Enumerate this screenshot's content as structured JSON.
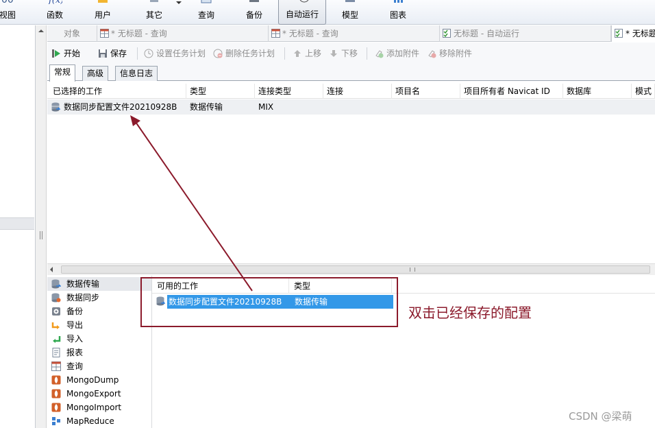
{
  "ribbon": {
    "items": [
      {
        "label": "视图",
        "icon": "view-icon"
      },
      {
        "label": "函数",
        "icon": "function-icon"
      },
      {
        "label": "用户",
        "icon": "user-icon"
      },
      {
        "label": "其它",
        "icon": "other-icon"
      },
      {
        "label": "查询",
        "icon": "query-icon"
      },
      {
        "label": "备份",
        "icon": "backup-icon"
      },
      {
        "label": "自动运行",
        "icon": "automation-icon",
        "active": true
      },
      {
        "label": "模型",
        "icon": "model-icon"
      },
      {
        "label": "图表",
        "icon": "chart-icon"
      }
    ]
  },
  "tabs": [
    {
      "label": "对象"
    },
    {
      "label": "* 无标题 - 查询",
      "icon": "query-tab-icon"
    },
    {
      "label": "* 无标题 - 查询",
      "icon": "query-tab-icon"
    },
    {
      "label": "无标题 - 自动运行",
      "icon": "automation-tab-icon"
    },
    {
      "label": "* 无标题",
      "icon": "automation-tab-icon",
      "active": true
    }
  ],
  "toolbar": {
    "start": "开始",
    "save": "保存",
    "set_schedule": "设置任务计划",
    "delete_schedule": "删除任务计划",
    "move_up": "上移",
    "move_down": "下移",
    "add_attachment": "添加附件",
    "remove_attachment": "移除附件"
  },
  "subtabs": {
    "general": "常规",
    "advanced": "高级",
    "log": "信息日志"
  },
  "grid": {
    "columns": [
      "已选择的工作",
      "类型",
      "连接类型",
      "连接",
      "项目名",
      "项目所有者 Navicat ID",
      "数据库",
      "模式"
    ],
    "rows": [
      [
        "数据同步配置文件20210928B",
        "数据传输",
        "MIX",
        "",
        "",
        "",
        "",
        ""
      ]
    ]
  },
  "typelist": {
    "items": [
      {
        "label": "数据传输",
        "icon": "data-transfer-icon",
        "selected": true
      },
      {
        "label": "数据同步",
        "icon": "data-sync-icon"
      },
      {
        "label": "备份",
        "icon": "backup-icon"
      },
      {
        "label": "导出",
        "icon": "export-icon"
      },
      {
        "label": "导入",
        "icon": "import-icon"
      },
      {
        "label": "报表",
        "icon": "report-icon"
      },
      {
        "label": "查询",
        "icon": "query-icon"
      },
      {
        "label": "MongoDump",
        "icon": "mongodump-icon"
      },
      {
        "label": "MongoExport",
        "icon": "mongoexport-icon"
      },
      {
        "label": "MongoImport",
        "icon": "mongoimport-icon"
      },
      {
        "label": "MapReduce",
        "icon": "mapreduce-icon"
      }
    ]
  },
  "available": {
    "columns": [
      "可用的工作",
      "类型"
    ],
    "rows": [
      [
        "数据同步配置文件20210928B",
        "数据传输"
      ]
    ]
  },
  "annotation": {
    "text": "双击已经保存的配置",
    "color": "#8b1a2b"
  },
  "watermark": "CSDN @梁萌",
  "colors": {
    "selection": "#3398e8",
    "annotation": "#8b1a2b"
  }
}
